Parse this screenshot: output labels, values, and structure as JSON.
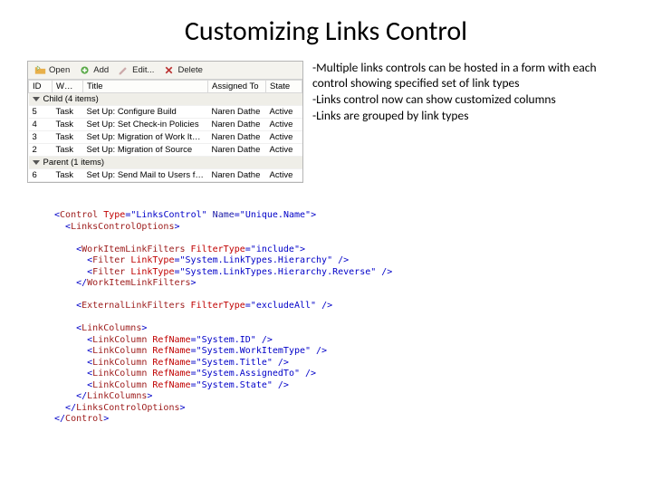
{
  "title": "Customizing Links Control",
  "toolbar": {
    "open": "Open",
    "add": "Add",
    "edit": "Edit...",
    "delete": "Delete"
  },
  "columns": [
    "ID",
    "W…",
    "Title",
    "Assigned To",
    "State"
  ],
  "groups": [
    {
      "label": "Child (4 items)",
      "rows": [
        {
          "id": "5",
          "w": "Task",
          "title": "Set Up: Configure Build",
          "assigned": "Naren Dathe",
          "state": "Active"
        },
        {
          "id": "4",
          "w": "Task",
          "title": "Set Up: Set Check-in Policies",
          "assigned": "Naren Dathe",
          "state": "Active"
        },
        {
          "id": "3",
          "w": "Task",
          "title": "Set Up: Migration of Work It…",
          "assigned": "Naren Dathe",
          "state": "Active"
        },
        {
          "id": "2",
          "w": "Task",
          "title": "Set Up: Migration of Source",
          "assigned": "Naren Dathe",
          "state": "Active"
        }
      ]
    },
    {
      "label": "Parent (1 items)",
      "rows": [
        {
          "id": "6",
          "w": "Task",
          "title": "Set Up: Send Mail to Users f…",
          "assigned": "Naren Dathe",
          "state": "Active"
        }
      ]
    }
  ],
  "bullets": {
    "b1": "-Multiple links controls can be hosted in a form with each control showing specified set of link types",
    "b2": "-Links control now can show customized columns",
    "b3": "-Links are grouped by link types"
  },
  "xml": {
    "control_type": "LinksControl",
    "control_name": "Unique.Name",
    "wif_type": "include",
    "wif_1": "System.LinkTypes.Hierarchy",
    "wif_2": "System.LinkTypes.Hierarchy.Reverse",
    "ext_type": "excludeAll",
    "cols": [
      "System.ID",
      "System.WorkItemType",
      "System.Title",
      "System.AssignedTo",
      "System.State"
    ]
  }
}
